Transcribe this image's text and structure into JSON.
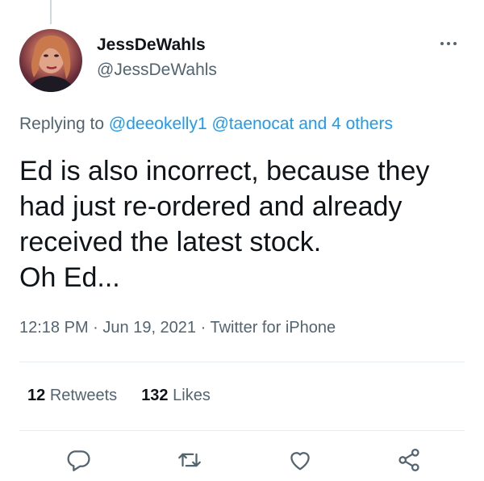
{
  "author": {
    "display_name": "JessDeWahls",
    "handle": "@JessDeWahls"
  },
  "reply": {
    "prefix": "Replying to ",
    "mention1": "@deeokelly1",
    "mention2": "@taenocat",
    "others": "and 4 others"
  },
  "tweet": {
    "lines": [
      "Ed is also incorrect, because they",
      "had just re-ordered and already",
      "received the latest stock.",
      "Oh Ed..."
    ]
  },
  "meta": {
    "time": "12:18 PM",
    "date": "Jun 19, 2021",
    "source": "Twitter for iPhone"
  },
  "stats": {
    "retweets_count": "12",
    "retweets_label": "Retweets",
    "likes_count": "132",
    "likes_label": "Likes"
  },
  "icons": {
    "more": "more-icon",
    "reply": "reply-icon",
    "retweet": "retweet-icon",
    "like": "heart-icon",
    "share": "share-icon"
  },
  "colors": {
    "link": "#1d9bf0",
    "secondary_text": "#536471",
    "primary_text": "#0f1419"
  }
}
